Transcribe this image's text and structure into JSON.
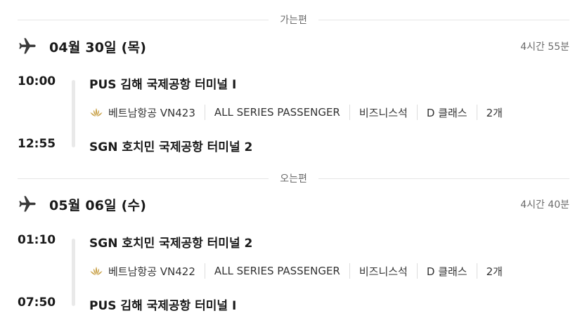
{
  "outbound": {
    "label": "가는편",
    "date": "04월 30일 (목)",
    "duration": "4시간 55분",
    "depart_time": "10:00",
    "depart_airport": "PUS 김해 국제공항 터미널 I",
    "arrive_time": "12:55",
    "arrive_airport": "SGN 호치민 국제공항 터미널 2",
    "airline_flight": "베트남항공 VN423",
    "fare_type": "ALL SERIES PASSENGER",
    "cabin": "비즈니스석",
    "booking_class": "D 클래스",
    "baggage": "2개"
  },
  "inbound": {
    "label": "오는편",
    "date": "05월 06일 (수)",
    "duration": "4시간 40분",
    "depart_time": "01:10",
    "depart_airport": "SGN 호치민 국제공항 터미널 2",
    "arrive_time": "07:50",
    "arrive_airport": "PUS 김해 국제공항 터미널 I",
    "airline_flight": "베트남항공 VN422",
    "fare_type": "ALL SERIES PASSENGER",
    "cabin": "비즈니스석",
    "booking_class": "D 클래스",
    "baggage": "2개"
  },
  "icons": {
    "plane": "airplane-icon",
    "airline_logo": "vietnam-airlines-lotus-icon"
  },
  "colors": {
    "text": "#1a1a1a",
    "muted": "#6b6b6b",
    "logo_gold": "#c9a24a"
  }
}
